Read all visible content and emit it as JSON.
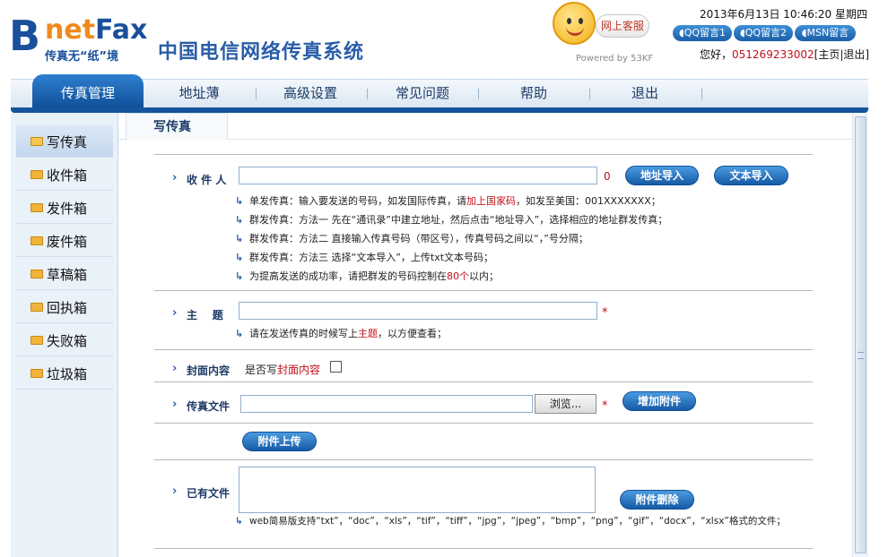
{
  "header": {
    "logo": {
      "b": "B",
      "net": "net",
      "fax": "Fax",
      "slogan": "传真无“纸”境"
    },
    "system_title": "中国电信网络传真系统",
    "customer_service": {
      "label": "网上客服",
      "powered": "Powered by 53KF"
    },
    "datetime": "2013年6月13日  10:46:20  星期四",
    "qq_buttons": [
      "QQ留言1",
      "QQ留言2",
      "MSN留言"
    ],
    "greeting_prefix": "您好，",
    "phone": "051269233002",
    "links": [
      "[主页",
      "|退出]"
    ]
  },
  "nav": {
    "items": [
      "传真管理",
      "地址薄",
      "高级设置",
      "常见问题",
      "帮助",
      "退出"
    ],
    "active_index": 0
  },
  "sidebar": {
    "items": [
      "写传真",
      "收件箱",
      "发件箱",
      "废件箱",
      "草稿箱",
      "回执箱",
      "失败箱",
      "垃圾箱"
    ],
    "active_index": 0
  },
  "main": {
    "tab": "写传真",
    "recipient": {
      "label": "收 件 人",
      "value": "",
      "count": "0",
      "address_import": "地址导入",
      "text_import": "文本导入",
      "hints": [
        {
          "pre": "单发传真：输入要发送的号码，如发国际传真，请",
          "em": "加上国家码",
          "post": "，如发至美国：001XXXXXXX；"
        },
        {
          "pre": "群发传真：方法一 先在“通讯录”中建立地址，然后点击“地址导入”，选择相应的地址群发传真；",
          "em": "",
          "post": ""
        },
        {
          "pre": "群发传真：方法二 直接输入传真号码（带区号），传真号码之间以“，”号分隔；",
          "em": "",
          "post": ""
        },
        {
          "pre": "群发传真：方法三 选择“文本导入”，上传txt文本号码；",
          "em": "",
          "post": ""
        },
        {
          "pre": "为提高发送的成功率，请把群发的号码控制在",
          "em": "80个",
          "post": "以内；"
        }
      ]
    },
    "subject": {
      "label": "主    题",
      "value": "",
      "hint_pre": "请在发送传真的时候写上",
      "hint_em": "主题",
      "hint_post": "，以方便查看；"
    },
    "cover": {
      "label": "封面内容",
      "text_pre": "是否写",
      "text_em": "封面内容",
      "checked": false
    },
    "fax_file": {
      "label": "传真文件",
      "value": "",
      "browse": "浏览...",
      "add_attachment": "增加附件"
    },
    "upload_button": "附件上传",
    "existing": {
      "label": "已有文件",
      "delete_button": "附件删除",
      "hint_line1": "web简易版支持“txt”，“doc”，“xls”，“tif”，“tiff”，“jpg”，“jpeg”，“bmp”，“png”，“gif”，“docx”，“xlsx”格式的文",
      "hint_line2": "件；"
    }
  },
  "colors": {
    "brand_blue": "#14549c",
    "accent_red": "#c0111b",
    "logo_orange": "#f08a1c"
  }
}
